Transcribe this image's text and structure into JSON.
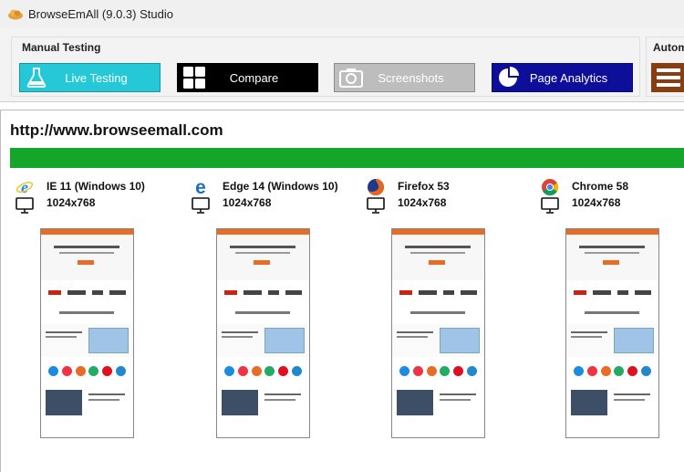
{
  "window": {
    "title": "BrowseEmAll (9.0.3) Studio",
    "logo_icon": "cloud-app-icon"
  },
  "ribbon": {
    "group_label": "Manual Testing",
    "group2_label": "Autom",
    "buttons": [
      {
        "label": "Live Testing",
        "icon": "flask-icon",
        "color": "#25c8d6"
      },
      {
        "label": "Compare",
        "icon": "grid-icon",
        "color": "#000000"
      },
      {
        "label": "Screenshots",
        "icon": "camera-icon",
        "color": "#bdbdbd"
      },
      {
        "label": "Page Analytics",
        "icon": "pie-chart-icon",
        "color": "#0d0e9a"
      }
    ],
    "automation_icon": "list-icon"
  },
  "content": {
    "url": "http://www.browseemall.com",
    "progress_fraction": 1.0,
    "progress_color": "#14a629",
    "browsers": [
      {
        "name": "IE 11 (Windows 10)",
        "resolution": "1024x768",
        "icon": "ie-icon"
      },
      {
        "name": "Edge 14 (Windows 10)",
        "resolution": "1024x768",
        "icon": "edge-icon"
      },
      {
        "name": "Firefox 53",
        "resolution": "1024x768",
        "icon": "firefox-icon"
      },
      {
        "name": "Chrome 58",
        "resolution": "1024x768",
        "icon": "chrome-icon"
      }
    ]
  }
}
